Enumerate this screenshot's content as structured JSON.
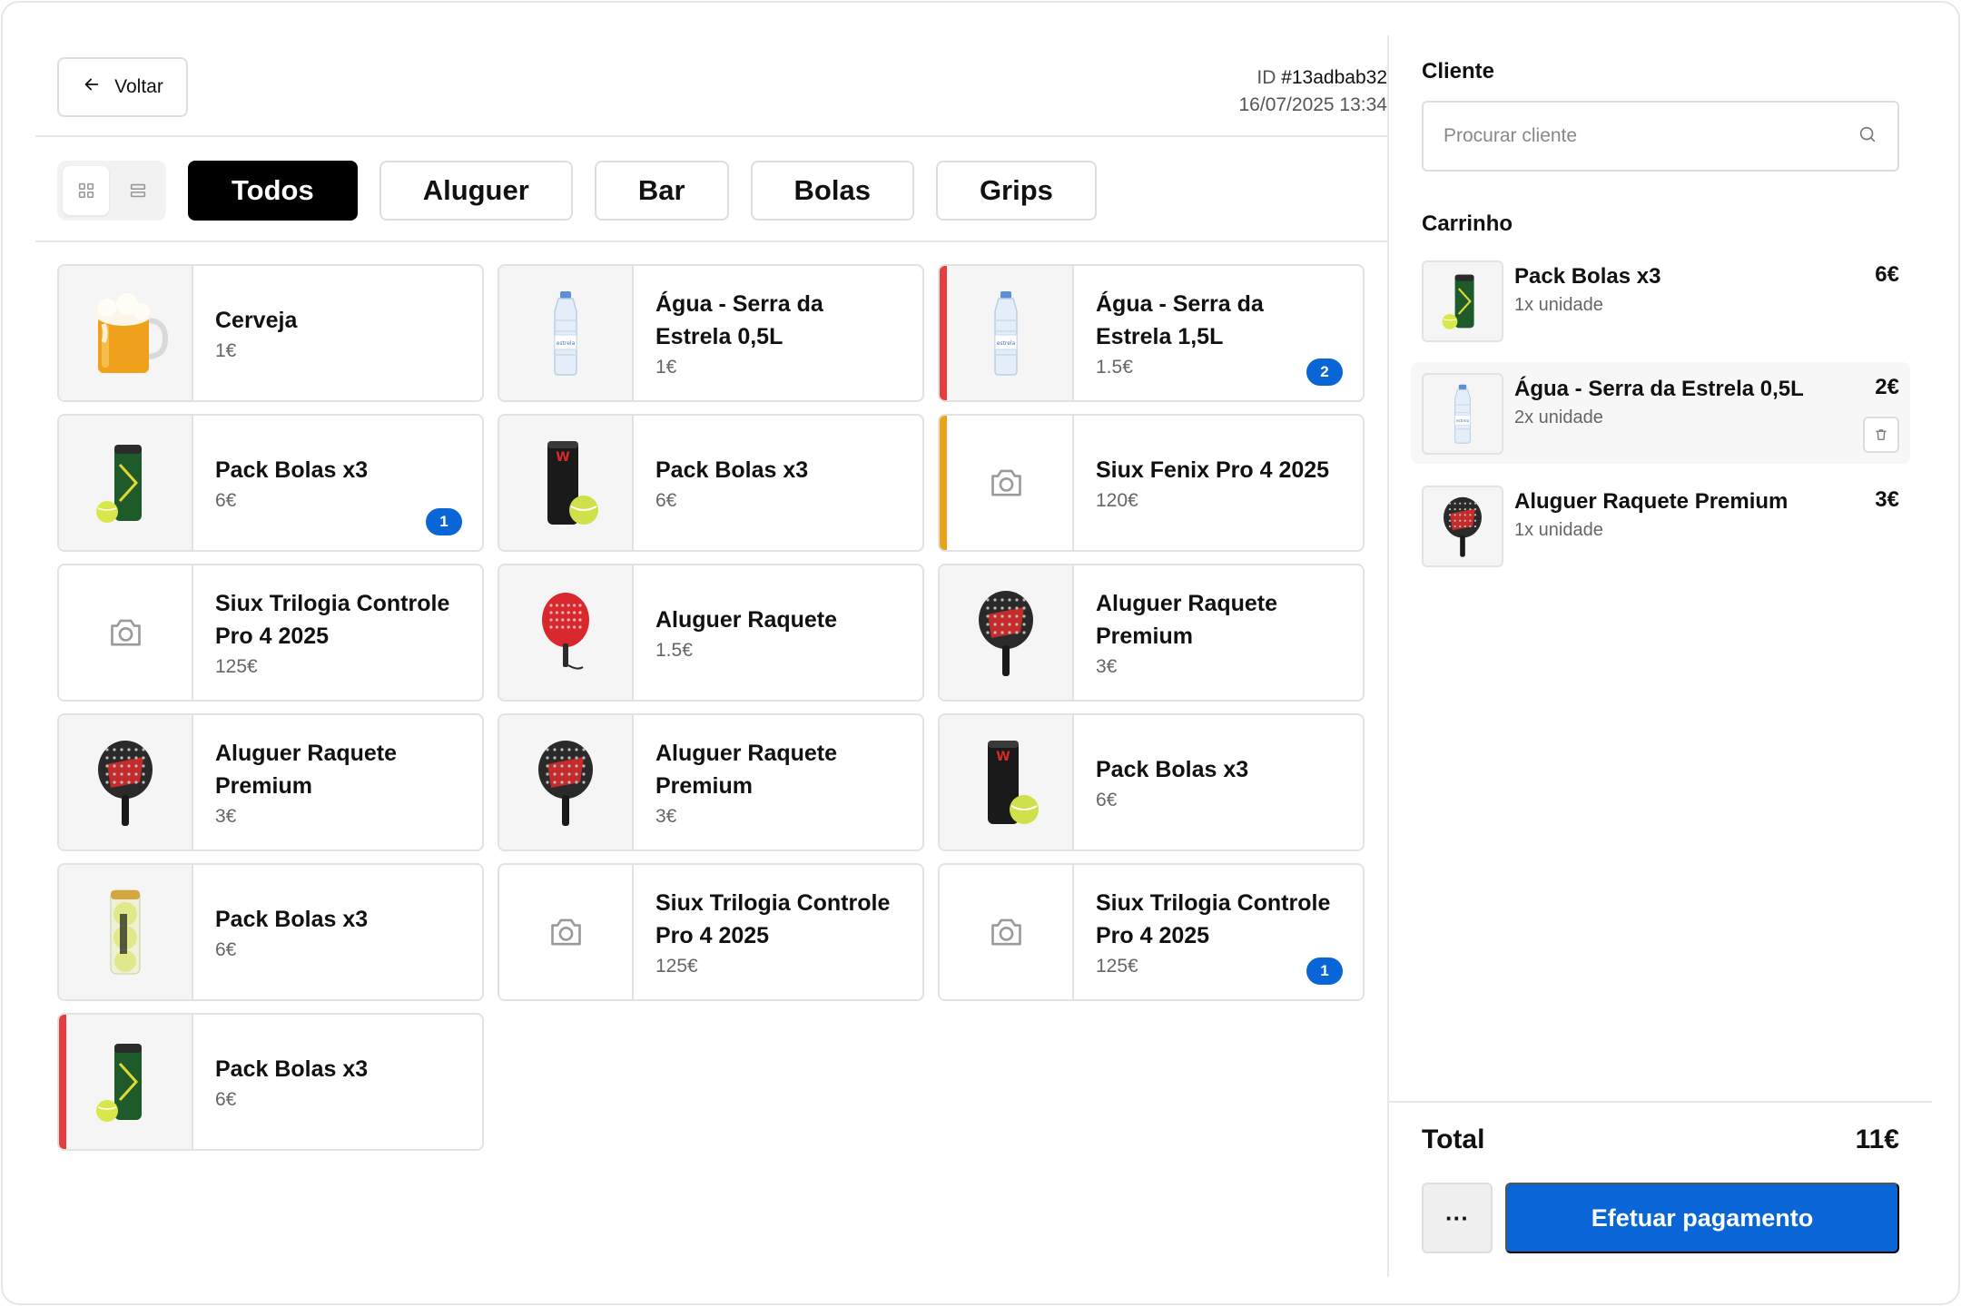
{
  "header": {
    "back_label": "Voltar",
    "id_label": "ID",
    "id_value": "#13adbab32",
    "datetime": "16/07/2025 13:34"
  },
  "view_toggle": {
    "active": "grid-view",
    "options": [
      "grid-view",
      "list-view"
    ]
  },
  "tabs": [
    {
      "label": "Todos",
      "active": true
    },
    {
      "label": "Aluguer",
      "active": false
    },
    {
      "label": "Bar",
      "active": false
    },
    {
      "label": "Bolas",
      "active": false
    },
    {
      "label": "Grips",
      "active": false
    }
  ],
  "products": [
    {
      "name": "Cerveja",
      "price": "1€",
      "image": "beer",
      "accent": null,
      "badge": null
    },
    {
      "name": "Água - Serra da Estrela 0,5L",
      "price": "1€",
      "image": "water",
      "accent": null,
      "badge": null
    },
    {
      "name": "Água - Serra da Estrela 1,5L",
      "price": "1.5€",
      "image": "water",
      "accent": "#e53e3e",
      "badge": "2"
    },
    {
      "name": "Pack Bolas x3",
      "price": "6€",
      "image": "balls-green",
      "accent": null,
      "badge": "1"
    },
    {
      "name": "Pack Bolas x3",
      "price": "6€",
      "image": "balls-black",
      "accent": null,
      "badge": null
    },
    {
      "name": "Siux Fenix Pro 4 2025",
      "price": "120€",
      "image": "placeholder",
      "accent": "#e8a317",
      "badge": null
    },
    {
      "name": "Siux Trilogia Controle Pro 4 2025",
      "price": "125€",
      "image": "placeholder",
      "accent": null,
      "badge": null
    },
    {
      "name": "Aluguer Raquete",
      "price": "1.5€",
      "image": "racket-red",
      "accent": null,
      "badge": null
    },
    {
      "name": "Aluguer Raquete Premium",
      "price": "3€",
      "image": "racket-premium",
      "accent": null,
      "badge": null
    },
    {
      "name": "Aluguer Raquete Premium",
      "price": "3€",
      "image": "racket-premium",
      "accent": null,
      "badge": null
    },
    {
      "name": "Aluguer Raquete Premium",
      "price": "3€",
      "image": "racket-premium",
      "accent": null,
      "badge": null
    },
    {
      "name": "Pack Bolas x3",
      "price": "6€",
      "image": "balls-black",
      "accent": null,
      "badge": null
    },
    {
      "name": "Pack Bolas x3",
      "price": "6€",
      "image": "balls-head",
      "accent": null,
      "badge": null
    },
    {
      "name": "Siux Trilogia Controle Pro 4 2025",
      "price": "125€",
      "image": "placeholder",
      "accent": null,
      "badge": null
    },
    {
      "name": "Siux Trilogia Controle Pro 4 2025",
      "price": "125€",
      "image": "placeholder",
      "accent": null,
      "badge": "1"
    },
    {
      "name": "Pack Bolas x3",
      "price": "6€",
      "image": "balls-green",
      "accent": "#e53e3e",
      "badge": null
    }
  ],
  "client": {
    "title": "Cliente",
    "search_placeholder": "Procurar cliente"
  },
  "cart": {
    "title": "Carrinho",
    "items": [
      {
        "name": "Pack Bolas x3",
        "qty": "1x unidade",
        "price": "6€",
        "image": "balls-green",
        "highlighted": false
      },
      {
        "name": "Água - Serra da Estrela 0,5L",
        "qty": "2x unidade",
        "price": "2€",
        "image": "water",
        "highlighted": true
      },
      {
        "name": "Aluguer Raquete Premium",
        "qty": "1x unidade",
        "price": "3€",
        "image": "racket-premium",
        "highlighted": false
      }
    ]
  },
  "footer": {
    "total_label": "Total",
    "total_value": "11€",
    "more_label": "···",
    "pay_label": "Efetuar pagamento"
  },
  "colors": {
    "primary": "#0a66d6",
    "accent_red": "#e53e3e",
    "accent_orange": "#e8a317",
    "tab_active_bg": "#000000"
  }
}
